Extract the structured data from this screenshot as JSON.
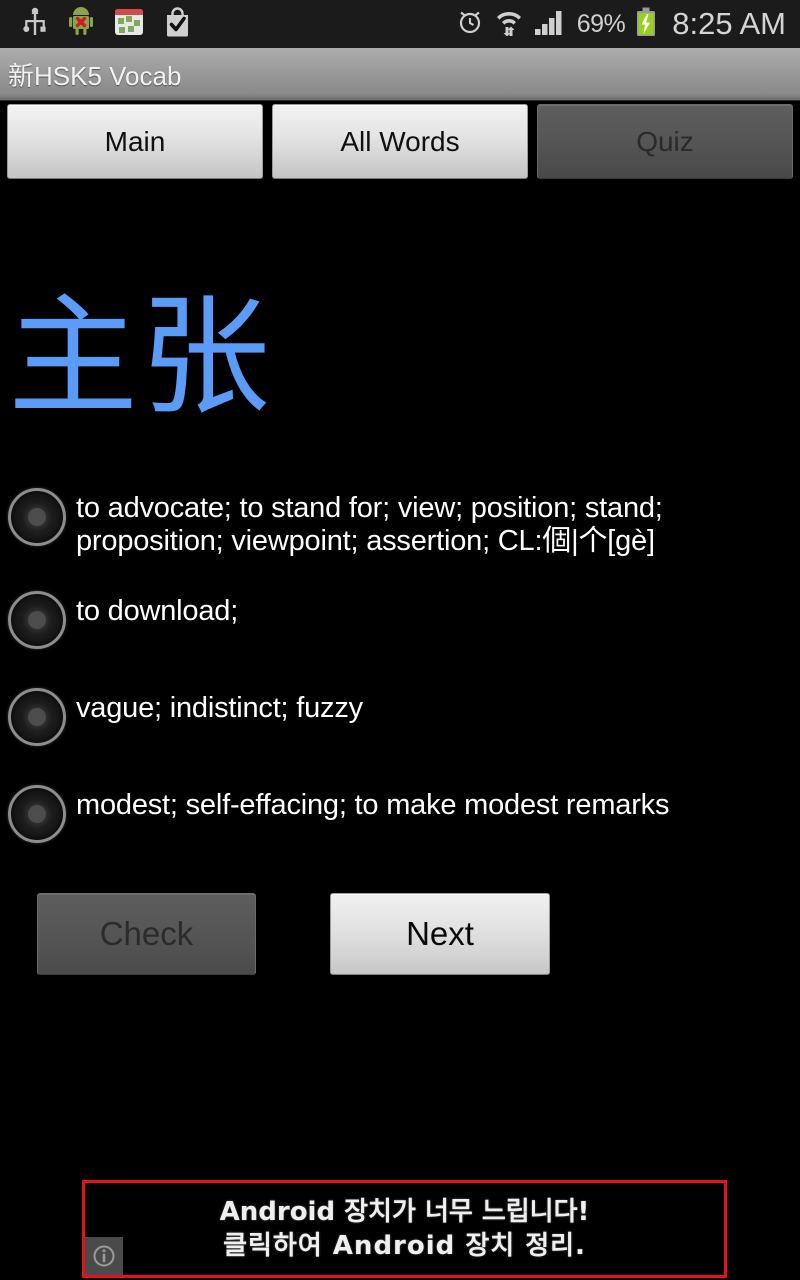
{
  "status_bar": {
    "icons_left": [
      "usb-icon",
      "android-debug-icon",
      "calendar-icon",
      "play-store-bag-icon"
    ],
    "icons_right": [
      "alarm-clock-icon",
      "wifi-transfer-icon",
      "signal-bars-icon",
      "battery-charging-icon"
    ],
    "battery_percent": "69%",
    "clock": "8:25 AM",
    "colors": {
      "background": "#1b1b1b",
      "text": "#cfcfcf",
      "battery_green": "#96d11e"
    }
  },
  "action_bar": {
    "title": "新HSK5 Vocab"
  },
  "tabs": [
    {
      "label": "Main",
      "state": "enabled",
      "name": "tab-main"
    },
    {
      "label": "All Words",
      "state": "enabled",
      "name": "tab-all-words"
    },
    {
      "label": "Quiz",
      "state": "disabled",
      "name": "tab-quiz"
    }
  ],
  "quiz": {
    "word": "主张",
    "word_color": "#5a9cf8",
    "options": [
      {
        "label": "to advocate; to stand for; view; position; stand; proposition; viewpoint; assertion; CL:個|个[gè]",
        "selected": false
      },
      {
        "label": "to download;",
        "selected": false
      },
      {
        "label": "vague; indistinct; fuzzy",
        "selected": false
      },
      {
        "label": "modest; self-effacing; to make modest remarks",
        "selected": false
      }
    ],
    "check_button": {
      "label": "Check",
      "state": "disabled"
    },
    "next_button": {
      "label": "Next",
      "state": "enabled"
    }
  },
  "ad": {
    "line1": "Android 장치가 너무 느립니다!",
    "line2": "클릭하여 Android 장치 정리.",
    "border_color": "#e8111b",
    "info_icon": "info-icon"
  }
}
